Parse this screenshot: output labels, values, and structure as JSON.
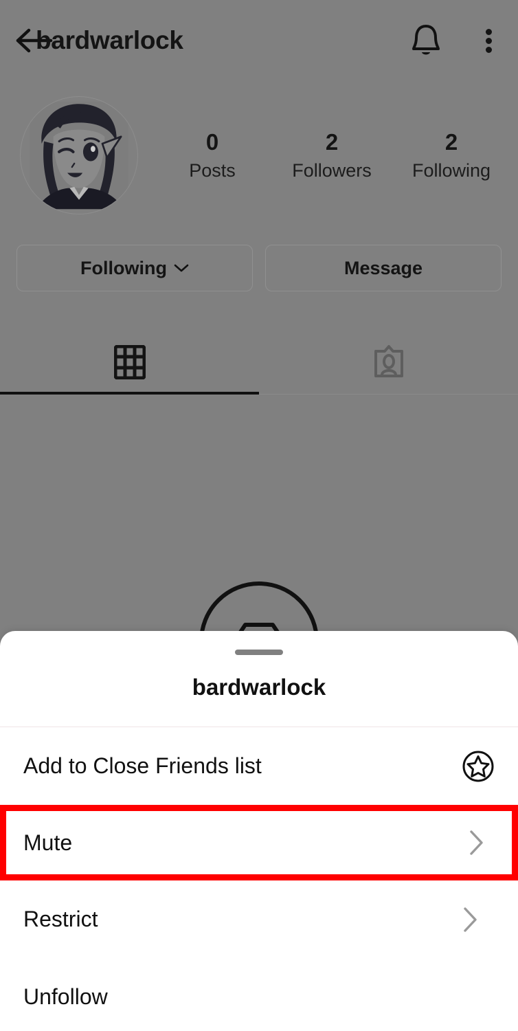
{
  "colors": {
    "overlay_dim": "#808080",
    "sheet_bg": "#ffffff",
    "highlight": "#ff0000",
    "text_primary": "#111111",
    "chevron": "#9a9a9a"
  },
  "header": {
    "back_icon": "arrow-left-icon",
    "title": "bardwarlock",
    "notify_icon": "bell-icon",
    "overflow_icon": "more-vertical-icon"
  },
  "profile": {
    "avatar_alt": "anime-character-avatar",
    "stats": [
      {
        "count": "0",
        "label": "Posts"
      },
      {
        "count": "2",
        "label": "Followers"
      },
      {
        "count": "2",
        "label": "Following"
      }
    ],
    "actions": [
      {
        "label": "Following",
        "icon": "chevron-down-icon"
      },
      {
        "label": "Message",
        "icon": ""
      }
    ],
    "tabs": [
      {
        "icon": "grid-icon",
        "active": true
      },
      {
        "icon": "tagged-icon",
        "active": false
      }
    ]
  },
  "sheet": {
    "handle": "drag-handle",
    "title": "bardwarlock",
    "items": [
      {
        "label": "Add to Close Friends list",
        "accessory": "star-circle-icon",
        "highlighted": false
      },
      {
        "label": "Mute",
        "accessory": "chevron-right-icon",
        "highlighted": true
      },
      {
        "label": "Restrict",
        "accessory": "chevron-right-icon",
        "highlighted": false
      },
      {
        "label": "Unfollow",
        "accessory": "",
        "highlighted": false
      }
    ]
  }
}
